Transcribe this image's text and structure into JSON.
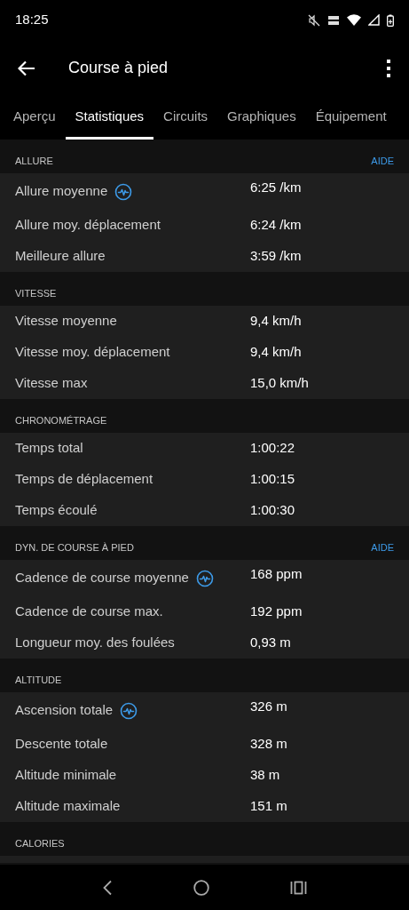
{
  "status_bar": {
    "time": "18:25"
  },
  "app_bar": {
    "title": "Course à pied"
  },
  "tabs": [
    {
      "label": "Aperçu",
      "selected": false
    },
    {
      "label": "Statistiques",
      "selected": true
    },
    {
      "label": "Circuits",
      "selected": false
    },
    {
      "label": "Graphiques",
      "selected": false
    },
    {
      "label": "Équipement",
      "selected": false
    }
  ],
  "sections": [
    {
      "title": "ALLURE",
      "help": "AIDE",
      "rows": [
        {
          "label": "Allure moyenne",
          "value": "6:25 /km",
          "chart_icon": true
        },
        {
          "label": "Allure moy. déplacement",
          "value": "6:24 /km",
          "chart_icon": false
        },
        {
          "label": "Meilleure allure",
          "value": "3:59 /km",
          "chart_icon": false
        }
      ]
    },
    {
      "title": "VITESSE",
      "rows": [
        {
          "label": "Vitesse moyenne",
          "value": "9,4 km/h",
          "chart_icon": false
        },
        {
          "label": "Vitesse moy. déplacement",
          "value": "9,4 km/h",
          "chart_icon": false
        },
        {
          "label": "Vitesse max",
          "value": "15,0 km/h",
          "chart_icon": false
        }
      ]
    },
    {
      "title": "CHRONOMÉTRAGE",
      "rows": [
        {
          "label": "Temps total",
          "value": "1:00:22",
          "chart_icon": false
        },
        {
          "label": "Temps de déplacement",
          "value": "1:00:15",
          "chart_icon": false
        },
        {
          "label": "Temps écoulé",
          "value": "1:00:30",
          "chart_icon": false
        }
      ]
    },
    {
      "title": "DYN. DE COURSE À PIED",
      "help": "AIDE",
      "rows": [
        {
          "label": "Cadence de course moyenne",
          "value": "168 ppm",
          "chart_icon": true
        },
        {
          "label": "Cadence de course max.",
          "value": "192 ppm",
          "chart_icon": false
        },
        {
          "label": "Longueur moy. des foulées",
          "value": "0,93 m",
          "chart_icon": false
        }
      ]
    },
    {
      "title": "ALTITUDE",
      "rows": [
        {
          "label": "Ascension totale",
          "value": "326 m",
          "chart_icon": true
        },
        {
          "label": "Descente totale",
          "value": "328 m",
          "chart_icon": false
        },
        {
          "label": "Altitude minimale",
          "value": "38 m",
          "chart_icon": false
        },
        {
          "label": "Altitude maximale",
          "value": "151 m",
          "chart_icon": false
        }
      ]
    },
    {
      "title": "CALORIES"
    }
  ]
}
